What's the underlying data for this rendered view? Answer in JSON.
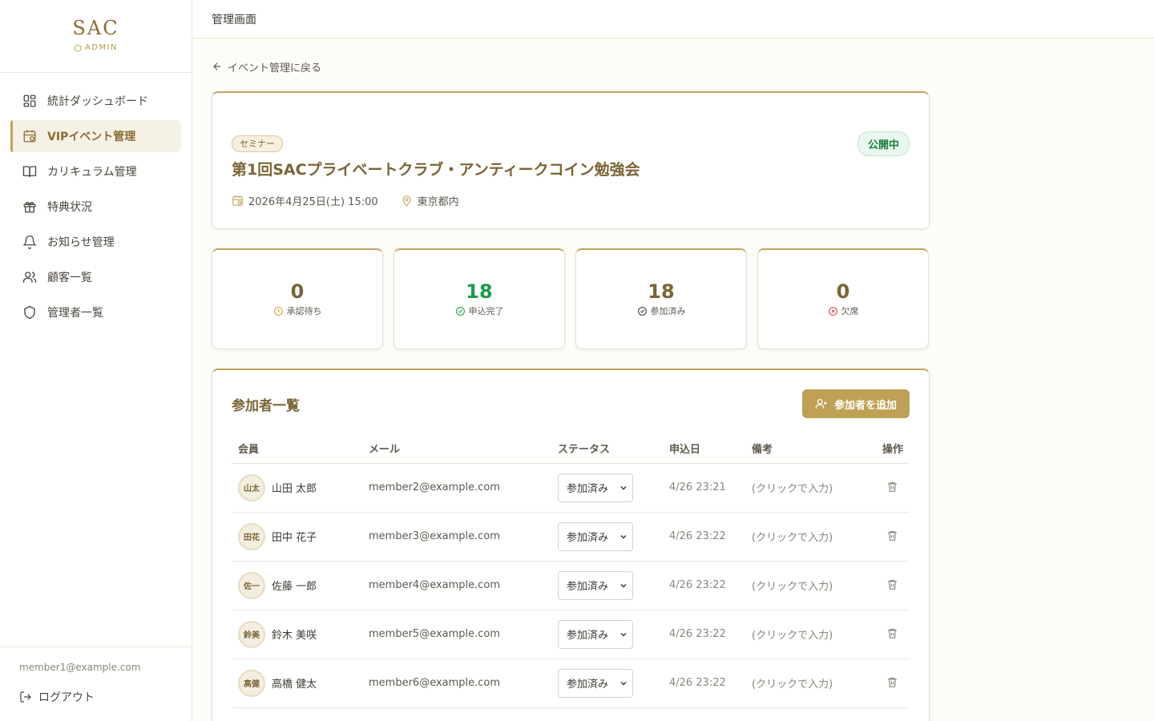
{
  "brand": {
    "title": "SAC",
    "subtitle": "ADMIN"
  },
  "sidebar": {
    "items": [
      {
        "label": "統計ダッシュボード",
        "icon": "dashboard-icon"
      },
      {
        "label": "VIPイベント管理",
        "icon": "calendar-icon",
        "active": true
      },
      {
        "label": "カリキュラム管理",
        "icon": "book-icon"
      },
      {
        "label": "特典状況",
        "icon": "gift-icon"
      },
      {
        "label": "お知らせ管理",
        "icon": "bell-icon"
      },
      {
        "label": "顧客一覧",
        "icon": "users-icon"
      },
      {
        "label": "管理者一覧",
        "icon": "shield-icon"
      }
    ],
    "user_email": "member1@example.com",
    "logout_label": "ログアウト"
  },
  "topbar": {
    "title": "管理画面"
  },
  "back_link": "イベント管理に戻る",
  "event": {
    "category": "セミナー",
    "status": "公開中",
    "title": "第1回SACプライベートクラブ・アンティークコイン勉強会",
    "datetime": "2026年4月25日(土) 15:00",
    "location": "東京都内"
  },
  "stats": [
    {
      "value": "0",
      "label": "承認待ち",
      "icon": "clock-icon",
      "color": "#e0a030"
    },
    {
      "value": "18",
      "label": "申込完了",
      "icon": "check-circle-icon",
      "color": "#1e9b4a"
    },
    {
      "value": "18",
      "label": "参加済み",
      "icon": "check-circle-icon",
      "color": "#3d3a33"
    },
    {
      "value": "0",
      "label": "欠席",
      "icon": "x-circle-icon",
      "color": "#e04848"
    }
  ],
  "participants": {
    "title": "参加者一覧",
    "add_button": "参加者を追加",
    "columns": [
      "会員",
      "メール",
      "ステータス",
      "申込日",
      "備考",
      "操作"
    ],
    "rows": [
      {
        "initials": "山太",
        "name": "山田 太郎",
        "email": "member2@example.com",
        "status": "参加済み",
        "date": "4/26 23:21",
        "note": "(クリックで入力)"
      },
      {
        "initials": "田花",
        "name": "田中 花子",
        "email": "member3@example.com",
        "status": "参加済み",
        "date": "4/26 23:22",
        "note": "(クリックで入力)"
      },
      {
        "initials": "佐一",
        "name": "佐藤 一郎",
        "email": "member4@example.com",
        "status": "参加済み",
        "date": "4/26 23:22",
        "note": "(クリックで入力)"
      },
      {
        "initials": "鈴美",
        "name": "鈴木 美咲",
        "email": "member5@example.com",
        "status": "参加済み",
        "date": "4/26 23:22",
        "note": "(クリックで入力)"
      },
      {
        "initials": "高健",
        "name": "高橋 健太",
        "email": "member6@example.com",
        "status": "参加済み",
        "date": "4/26 23:22",
        "note": "(クリックで入力)"
      }
    ]
  },
  "colors": {
    "accent": "#c2a35a",
    "accent_dark": "#7a6534",
    "button": "#bea154",
    "success": "#1e9b4a"
  }
}
